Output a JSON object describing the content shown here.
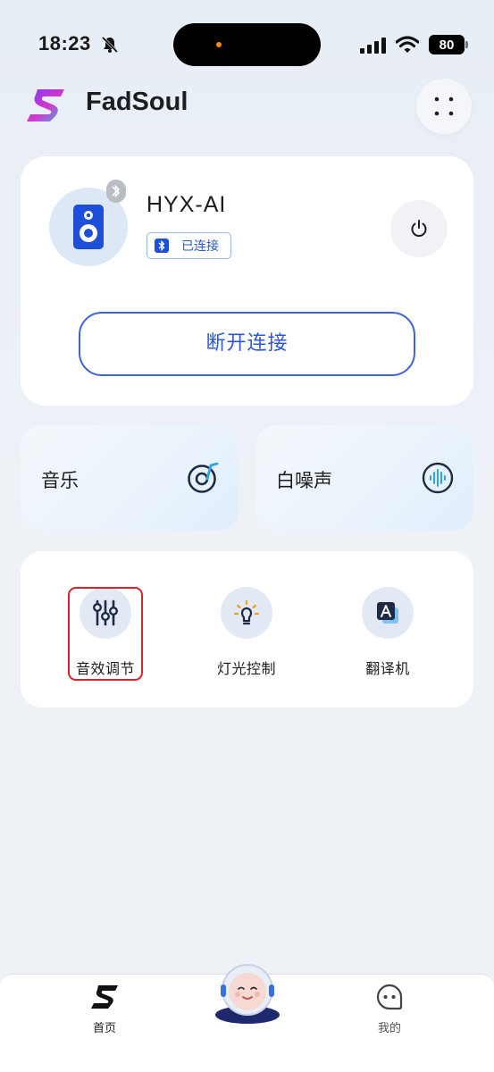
{
  "status_bar": {
    "time": "18:23",
    "battery": "80"
  },
  "header": {
    "app_title": "FadSoul"
  },
  "device": {
    "name": "HYX-AI",
    "status": "已连接",
    "disconnect_label": "断开连接"
  },
  "features": [
    {
      "label": "音乐",
      "icon": "music-disc-icon"
    },
    {
      "label": "白噪声",
      "icon": "sound-wave-icon"
    }
  ],
  "tools": [
    {
      "label": "音效调节",
      "icon": "equalizer-icon"
    },
    {
      "label": "灯光控制",
      "icon": "bulb-icon"
    },
    {
      "label": "翻译机",
      "icon": "translate-icon"
    }
  ],
  "bottom_nav": {
    "home_label": "首页",
    "mine_label": "我的"
  },
  "colors": {
    "accent": "#2d57d0",
    "highlight": "#d6252a",
    "icon_dark": "#1f2a44"
  }
}
